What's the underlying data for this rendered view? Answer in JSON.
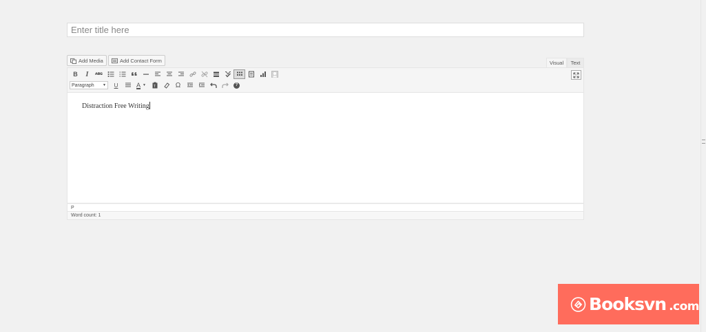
{
  "title_field": {
    "placeholder": "Enter title here"
  },
  "media_buttons": {
    "add_media": "Add Media",
    "add_contact_form": "Add Contact Form"
  },
  "mode_tabs": {
    "visual": "Visual",
    "text": "Text",
    "active": "visual"
  },
  "toolbar": {
    "row1": [
      "bold-icon",
      "italic-icon",
      "strikethrough-icon",
      "bullet-list-icon",
      "numbered-list-icon",
      "blockquote-icon",
      "horizontal-rule-icon",
      "align-left-icon",
      "align-center-icon",
      "align-right-icon",
      "link-icon",
      "unlink-icon",
      "read-more-icon",
      "spellcheck-icon",
      "kitchen-sink-icon",
      "insert-contact-form-icon",
      "chart-icon",
      "avatar-icon"
    ],
    "row2": [
      "underline-icon",
      "justify-icon",
      "text-color-icon",
      "paste-text-icon",
      "clear-formatting-icon",
      "special-character-icon",
      "outdent-icon",
      "indent-icon",
      "undo-icon",
      "redo-icon",
      "help-icon"
    ],
    "labels": {
      "bold": "B",
      "italic": "I",
      "strike": "ABC",
      "underline": "U",
      "text_color": "A",
      "omega": "Ω",
      "help": "?"
    },
    "format_select": {
      "value": "Paragraph"
    }
  },
  "editor": {
    "content": "Distraction Free Writing"
  },
  "status": {
    "path": "P",
    "word_count": "Word count: 1"
  },
  "watermark": {
    "brand": "Booksvn",
    "tld": ".com",
    "color": "#ff6c5c"
  }
}
